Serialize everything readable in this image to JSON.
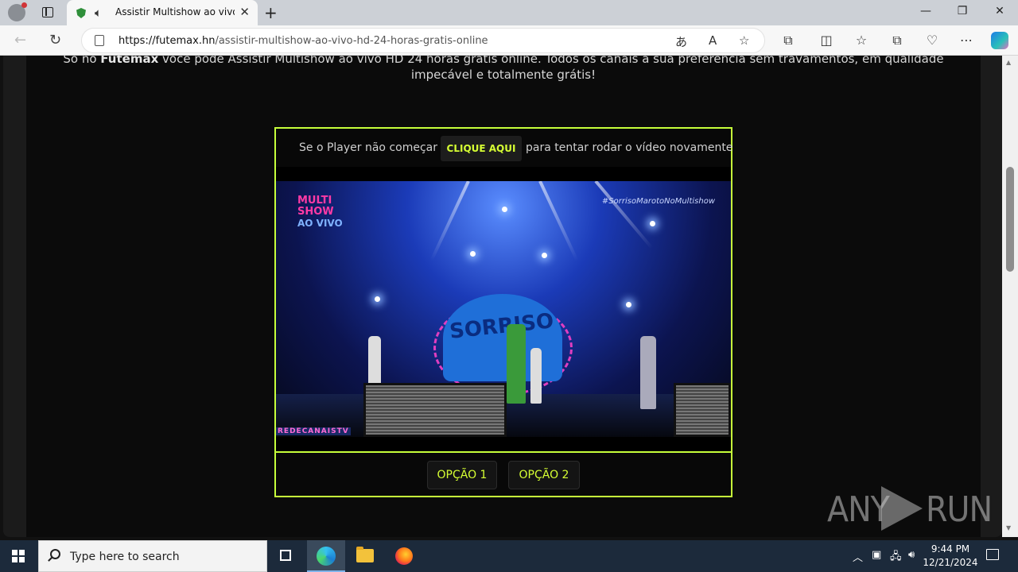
{
  "browser": {
    "tab_title": "Assistir Multishow ao vivo HD 24 horas grátis online",
    "tab_close": "✕",
    "new_tab": "+",
    "url_domain": "https://futemax.hn",
    "url_path": "/assistir-multishow-ao-vivo-hd-24-horas-gratis-online",
    "window_controls": {
      "minimize": "—",
      "restore": "❐",
      "close": "✕"
    }
  },
  "page": {
    "intro_prefix": "Só no ",
    "intro_brand": "Futemax",
    "intro_rest": " você pode Assistir Multishow ao vivo HD 24 horas grátis online. Todos os canais à sua preferência sem travamentos, em qualidade impecável e totalmente grátis!",
    "notice_before": "Se o Player não começar",
    "notice_button": "CLIQUE AQUI",
    "notice_after": "para tentar rodar o vídeo novamente",
    "video": {
      "logo_line1": "MULTI",
      "logo_line2": "SHOW",
      "logo_line3": "AO VIVO",
      "hashtag": "#SorrisoMarotoNoMultishow",
      "watermark": "REDECANAISTV",
      "screen_text": "SORRISO"
    },
    "options": [
      "OPÇÃO 1",
      "OPÇÃO 2"
    ]
  },
  "watermark": {
    "left": "ANY",
    "right": "RUN"
  },
  "taskbar": {
    "search_placeholder": "Type here to search",
    "time": "9:44 PM",
    "date": "12/21/2024"
  },
  "colors": {
    "accent": "#c6ff3a",
    "button_text": "#d6ff33",
    "taskbar": "#1c2a3b"
  }
}
